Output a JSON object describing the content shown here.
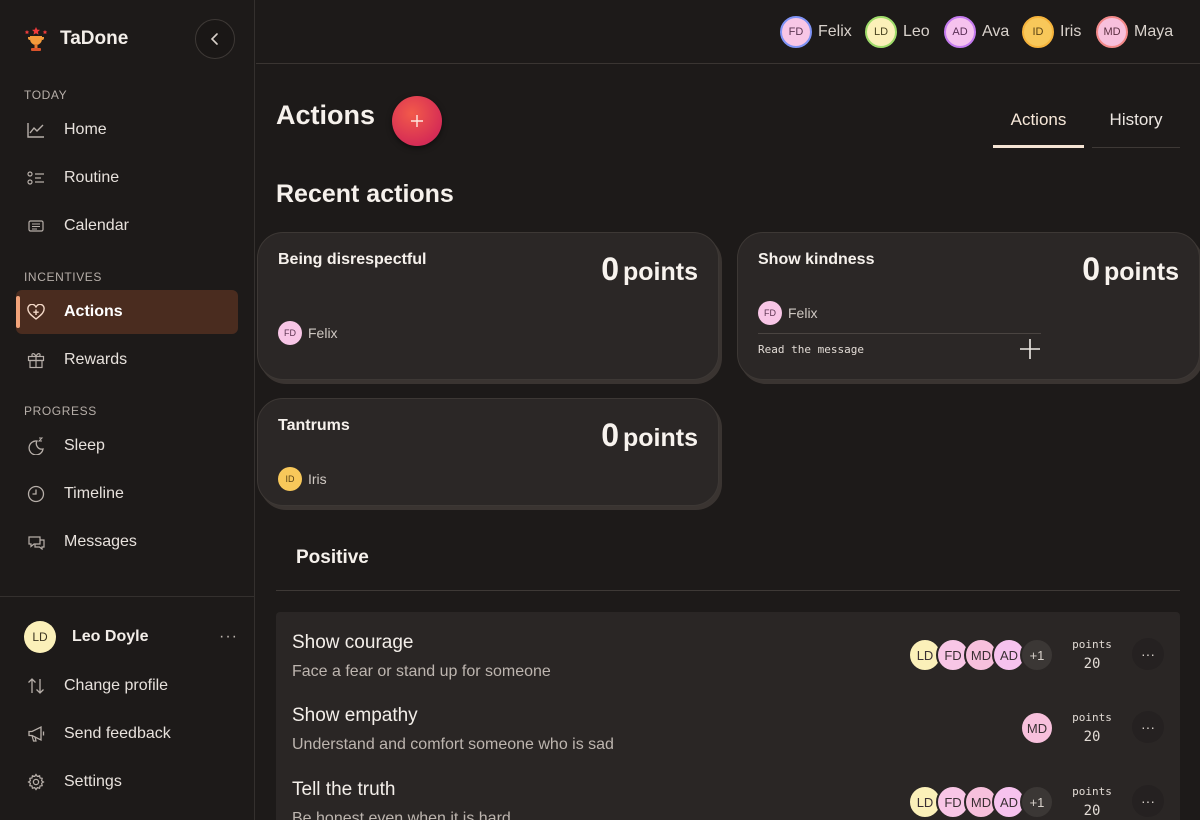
{
  "app": {
    "name": "TaDone"
  },
  "sidebar": {
    "sections": {
      "today": "TODAY",
      "incentives": "INCENTIVES",
      "progress": "PROGRESS"
    },
    "items": {
      "home": "Home",
      "routine": "Routine",
      "calendar": "Calendar",
      "actions": "Actions",
      "rewards": "Rewards",
      "sleep": "Sleep",
      "timeline": "Timeline",
      "messages": "Messages"
    },
    "active_item": "Actions",
    "profile": {
      "initials": "LD",
      "name": "Leo Doyle",
      "more": "···"
    },
    "footer": {
      "change_profile": "Change profile",
      "send_feedback": "Send feedback",
      "settings": "Settings"
    }
  },
  "members": [
    {
      "initials": "FD",
      "name": "Felix",
      "ring": "#7f93f5",
      "fill": "#f8c6e6"
    },
    {
      "initials": "LD",
      "name": "Leo",
      "ring": "#9fdc6a",
      "fill": "#fbf0b9"
    },
    {
      "initials": "AD",
      "name": "Ava",
      "ring": "#c57bf0",
      "fill": "#f6c2ee"
    },
    {
      "initials": "ID",
      "name": "Iris",
      "ring": "#f6b43c",
      "fill": "#f8c85a"
    },
    {
      "initials": "MD",
      "name": "Maya",
      "ring": "#f38a8a",
      "fill": "#f7c0dc"
    }
  ],
  "main": {
    "title": "Actions",
    "tabs": {
      "actions": "Actions",
      "history": "History"
    },
    "recent_title": "Recent actions",
    "recent": [
      {
        "title": "Being disrespectful",
        "points": "0",
        "points_label": "points",
        "member_initials": "FD",
        "member_name": "Felix"
      },
      {
        "title": "Show kindness",
        "points": "0",
        "points_label": "points",
        "member_initials": "FD",
        "member_name": "Felix",
        "note": "Read the message"
      },
      {
        "title": "Tantrums",
        "points": "0",
        "points_label": "points",
        "member_initials": "ID",
        "member_name": "Iris"
      }
    ],
    "positive_title": "Positive",
    "positive": [
      {
        "title": "Show courage",
        "desc": "Face a fear or stand up for someone",
        "avatars": [
          "LD",
          "FD",
          "MD",
          "AD"
        ],
        "extra": "+1",
        "points_label": "points",
        "points": "20",
        "more": "···"
      },
      {
        "title": "Show empathy",
        "desc": "Understand and comfort someone who is sad",
        "avatars": [
          "MD"
        ],
        "points_label": "points",
        "points": "20",
        "more": "···"
      },
      {
        "title": "Tell the truth",
        "desc": "Be honest even when it is hard",
        "avatars": [
          "LD",
          "FD",
          "MD",
          "AD"
        ],
        "extra": "+1",
        "points_label": "points",
        "points": "20",
        "more": "···"
      }
    ]
  },
  "colors": {
    "accent": "#f1a37a",
    "active_bg": "#4a2c1f",
    "add_button": "#e23d52",
    "avatar_ld": "#fbf0b9",
    "avatar_fd": "#f8c6e6",
    "avatar_md": "#f7c0dc",
    "avatar_ad": "#f6c2ee",
    "avatar_id": "#f8c85a",
    "avatar_extra": "#3b3735"
  }
}
